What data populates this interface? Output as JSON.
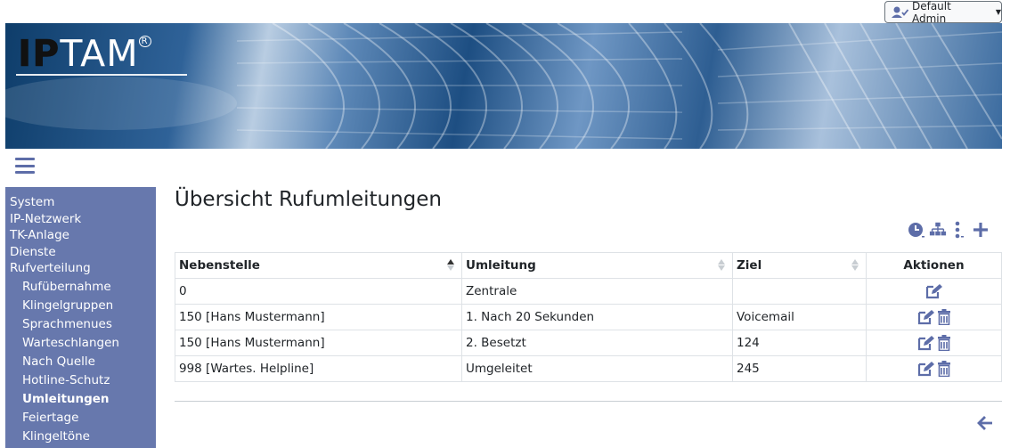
{
  "user_menu": {
    "label": "Default Admin",
    "icon": "user-check-icon"
  },
  "logo": {
    "text_bold": "IP",
    "text_rest": "TAM",
    "reg_mark": "R"
  },
  "sidebar": {
    "items": [
      {
        "label": "System"
      },
      {
        "label": "IP-Netzwerk"
      },
      {
        "label": "TK-Anlage"
      },
      {
        "label": "Dienste"
      },
      {
        "label": "Rufverteilung"
      }
    ],
    "sub_items": [
      {
        "label": "Rufübernahme"
      },
      {
        "label": "Klingelgruppen"
      },
      {
        "label": "Sprachmenues"
      },
      {
        "label": "Warteschlangen"
      },
      {
        "label": "Nach Quelle"
      },
      {
        "label": "Hotline-Schutz"
      },
      {
        "label": "Umleitungen",
        "active": true
      },
      {
        "label": "Feiertage"
      },
      {
        "label": "Klingeltöne"
      }
    ]
  },
  "page": {
    "title": "Übersicht Rufumleitungen"
  },
  "toolbar": {
    "icons": [
      "clock-icon",
      "sitemap-icon",
      "ellipsis-vertical-icon",
      "plus-icon"
    ]
  },
  "table": {
    "headers": [
      "Nebenstelle",
      "Umleitung",
      "Ziel",
      "Aktionen"
    ],
    "rows": [
      {
        "nebenstelle": "0",
        "umleitung": "Zentrale",
        "ziel": "",
        "actions": [
          "edit"
        ]
      },
      {
        "nebenstelle": "150 [Hans Mustermann]",
        "umleitung": "1. Nach 20 Sekunden",
        "ziel": "Voicemail",
        "actions": [
          "edit",
          "delete"
        ]
      },
      {
        "nebenstelle": "150 [Hans Mustermann]",
        "umleitung": "2. Besetzt",
        "ziel": "124",
        "actions": [
          "edit",
          "delete"
        ]
      },
      {
        "nebenstelle": "998 [Wartes. Helpline]",
        "umleitung": "Umgeleitet",
        "ziel": "245",
        "actions": [
          "edit",
          "delete"
        ]
      }
    ]
  },
  "colors": {
    "accent": "#5d6da8",
    "sidebar_bg": "#6778ad",
    "border": "#dee2e6"
  }
}
